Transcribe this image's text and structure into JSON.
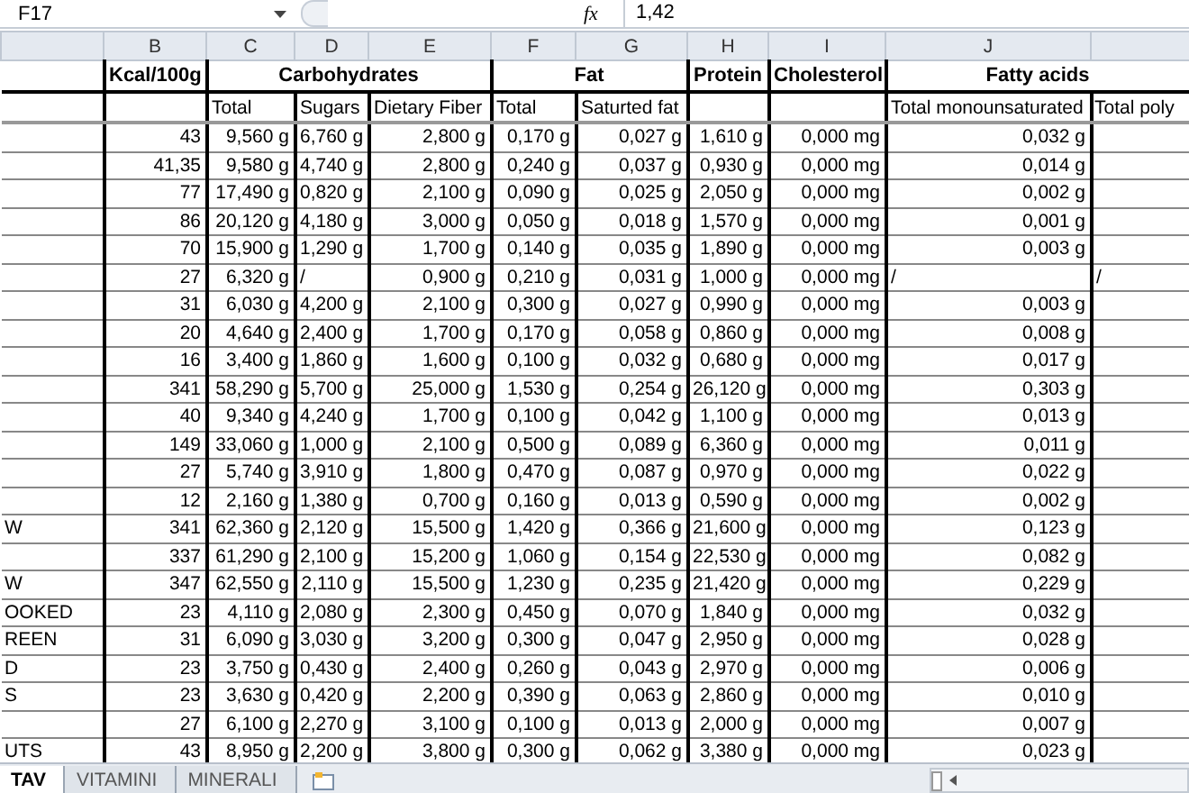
{
  "formula_bar": {
    "name_box": "F17",
    "fx": "fx",
    "value": "1,42"
  },
  "header_groups": [
    {
      "title": "Kcal/100g",
      "columns": [
        {
          "letter": "B"
        }
      ]
    },
    {
      "title": "Carbohydrates",
      "columns": [
        {
          "letter": "C",
          "subtitle": "Total"
        },
        {
          "letter": "D",
          "subtitle": "Sugars"
        },
        {
          "letter": "E",
          "subtitle": "Dietary Fiber"
        }
      ]
    },
    {
      "title": "Fat",
      "columns": [
        {
          "letter": "F",
          "subtitle": "Total"
        },
        {
          "letter": "G",
          "subtitle": "Saturted fat"
        }
      ]
    },
    {
      "title": "Protein",
      "columns": [
        {
          "letter": "H"
        }
      ]
    },
    {
      "title": "Cholesterol",
      "columns": [
        {
          "letter": "I"
        }
      ]
    },
    {
      "title": "Fatty acids",
      "columns": [
        {
          "letter": "J",
          "subtitle": "Total monounsaturated"
        },
        {
          "subtitle": "Total poly"
        }
      ]
    }
  ],
  "rows": [
    {
      "values": [
        "43",
        "9,560 g",
        "6,760 g",
        "2,800 g",
        "0,170 g",
        "0,027 g",
        "1,610 g",
        "0,000 mg",
        "0,032 g"
      ]
    },
    {
      "values": [
        "41,35",
        "9,580 g",
        "4,740 g",
        "2,800 g",
        "0,240 g",
        "0,037 g",
        "0,930 g",
        "0,000 mg",
        "0,014 g"
      ]
    },
    {
      "values": [
        "77",
        "17,490 g",
        "0,820 g",
        "2,100 g",
        "0,090 g",
        "0,025 g",
        "2,050 g",
        "0,000 mg",
        "0,002 g"
      ]
    },
    {
      "values": [
        "86",
        "20,120 g",
        "4,180 g",
        "3,000 g",
        "0,050 g",
        "0,018 g",
        "1,570 g",
        "0,000 mg",
        "0,001 g"
      ]
    },
    {
      "values": [
        "70",
        "15,900 g",
        "1,290 g",
        "1,700 g",
        "0,140 g",
        "0,035 g",
        "1,890 g",
        "0,000 mg",
        "0,003 g"
      ]
    },
    {
      "values": [
        "27",
        "6,320 g",
        "/",
        "0,900 g",
        "0,210 g",
        "0,031 g",
        "1,000 g",
        "0,000 mg",
        "/",
        "/"
      ]
    },
    {
      "values": [
        "31",
        "6,030 g",
        "4,200 g",
        "2,100 g",
        "0,300 g",
        "0,027 g",
        "0,990 g",
        "0,000 mg",
        "0,003 g"
      ]
    },
    {
      "values": [
        "20",
        "4,640 g",
        "2,400 g",
        "1,700 g",
        "0,170 g",
        "0,058 g",
        "0,860 g",
        "0,000 mg",
        "0,008 g"
      ]
    },
    {
      "values": [
        "16",
        "3,400 g",
        "1,860 g",
        "1,600 g",
        "0,100 g",
        "0,032 g",
        "0,680 g",
        "0,000 mg",
        "0,017 g"
      ]
    },
    {
      "values": [
        "341",
        "58,290 g",
        "5,700 g",
        "25,000 g",
        "1,530 g",
        "0,254 g",
        "26,120 g",
        "0,000 mg",
        "0,303 g"
      ]
    },
    {
      "values": [
        "40",
        "9,340 g",
        "4,240 g",
        "1,700 g",
        "0,100 g",
        "0,042 g",
        "1,100 g",
        "0,000 mg",
        "0,013 g"
      ]
    },
    {
      "values": [
        "149",
        "33,060 g",
        "1,000 g",
        "2,100 g",
        "0,500 g",
        "0,089 g",
        "6,360 g",
        "0,000 mg",
        "0,011 g"
      ]
    },
    {
      "values": [
        "27",
        "5,740 g",
        "3,910 g",
        "1,800 g",
        "0,470 g",
        "0,087 g",
        "0,970 g",
        "0,000 mg",
        "0,022 g"
      ]
    },
    {
      "values": [
        "12",
        "2,160 g",
        "1,380 g",
        "0,700 g",
        "0,160 g",
        "0,013 g",
        "0,590 g",
        "0,000 mg",
        "0,002 g"
      ]
    },
    {
      "label": "W",
      "values": [
        "341",
        "62,360 g",
        "2,120 g",
        "15,500 g",
        "1,420 g",
        "0,366 g",
        "21,600 g",
        "0,000 mg",
        "0,123 g"
      ]
    },
    {
      "values": [
        "337",
        "61,290 g",
        "2,100 g",
        "15,200 g",
        "1,060 g",
        "0,154 g",
        "22,530 g",
        "0,000 mg",
        "0,082 g"
      ]
    },
    {
      "label": "W",
      "values": [
        "347",
        "62,550 g",
        "2,110 g",
        "15,500 g",
        "1,230 g",
        "0,235 g",
        "21,420 g",
        "0,000 mg",
        "0,229 g"
      ]
    },
    {
      "label": "OOKED",
      "values": [
        "23",
        "4,110 g",
        "2,080 g",
        "2,300 g",
        "0,450 g",
        "0,070 g",
        "1,840 g",
        "0,000 mg",
        "0,032 g"
      ]
    },
    {
      "label": "REEN",
      "values": [
        "31",
        "6,090 g",
        "3,030 g",
        "3,200 g",
        "0,300 g",
        "0,047 g",
        "2,950 g",
        "0,000 mg",
        "0,028 g"
      ]
    },
    {
      "label": "D",
      "values": [
        "23",
        "3,750 g",
        "0,430 g",
        "2,400 g",
        "0,260 g",
        "0,043 g",
        "2,970 g",
        "0,000 mg",
        "0,006 g"
      ]
    },
    {
      "label": "S",
      "values": [
        "23",
        "3,630 g",
        "0,420 g",
        "2,200 g",
        "0,390 g",
        "0,063 g",
        "2,860 g",
        "0,000 mg",
        "0,010 g"
      ]
    },
    {
      "values": [
        "27",
        "6,100 g",
        "2,270 g",
        "3,100 g",
        "0,100 g",
        "0,013 g",
        "2,000 g",
        "0,000 mg",
        "0,007 g"
      ]
    },
    {
      "label": "UTS",
      "values": [
        "43",
        "8,950 g",
        "2,200 g",
        "3,800 g",
        "0,300 g",
        "0,062 g",
        "3,380 g",
        "0,000 mg",
        "0,023 g"
      ]
    }
  ],
  "sheet_tabs": [
    {
      "label": "TAV",
      "selected": true
    },
    {
      "label": "VITAMINI",
      "selected": false
    },
    {
      "label": "MINERALI",
      "selected": false
    }
  ]
}
